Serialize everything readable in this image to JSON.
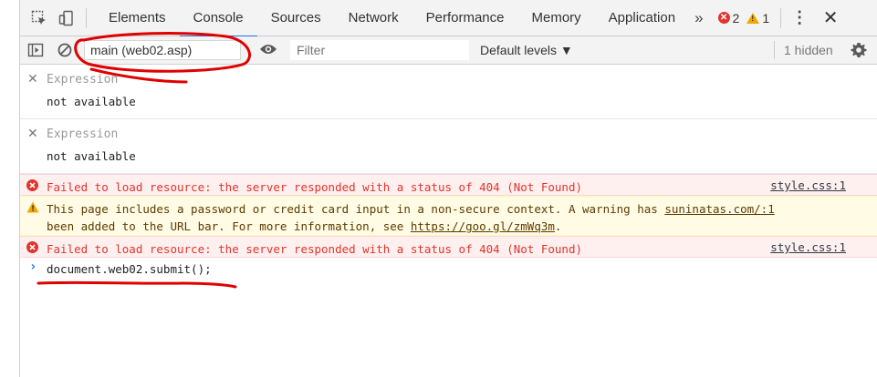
{
  "tabs": [
    {
      "label": "Elements"
    },
    {
      "label": "Console"
    },
    {
      "label": "Sources"
    },
    {
      "label": "Network"
    },
    {
      "label": "Performance"
    },
    {
      "label": "Memory"
    },
    {
      "label": "Application"
    }
  ],
  "more_tabs": "»",
  "counters": {
    "errors": "2",
    "warnings": "1"
  },
  "toolbar": {
    "context": "main (web02.asp)",
    "filter_placeholder": "Filter",
    "levels": "Default levels ▼",
    "hidden": "1 hidden"
  },
  "expressions": [
    {
      "label": "Expression",
      "value": "not available"
    },
    {
      "label": "Expression",
      "value": "not available"
    }
  ],
  "messages": {
    "error1": {
      "text": "Failed to load resource: the server responded with a status of 404 (Not Found)",
      "source": "style.css:1"
    },
    "warning": {
      "line1": "This page includes a password or credit card input in a non-secure context. A warning has ",
      "line1_link": "suninatas.com/:1",
      "line2_pre": "been added to the URL bar. For more information, see ",
      "line2_link": "https://goo.gl/zmWq3m",
      "line2_post": "."
    },
    "error2": {
      "text": "Failed to load resource: the server responded with a status of 404 (Not Found)",
      "source": "style.css:1"
    }
  },
  "prompt": {
    "command": "document.web02.submit();"
  },
  "colors": {
    "error": "#e0342c",
    "warning": "#f2a600",
    "accent": "#1a73e8",
    "annotation": "#e00000"
  }
}
